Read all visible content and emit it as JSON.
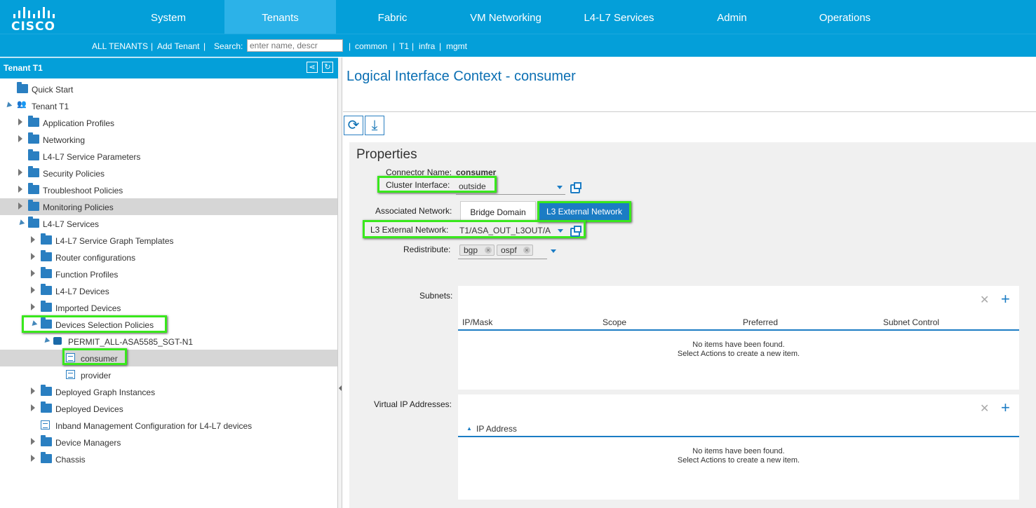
{
  "brand": {
    "name": "CISCO"
  },
  "nav": {
    "tabs": [
      "System",
      "Tenants",
      "Fabric",
      "VM Networking",
      "L4-L7 Services",
      "Admin",
      "Operations"
    ],
    "active": "Tenants"
  },
  "subnav": {
    "all_tenants": "ALL TENANTS",
    "add_tenant": "Add Tenant",
    "sep": "|",
    "search_label": "Search:",
    "search_placeholder": "enter name, descr",
    "tenants": [
      "common",
      "T1",
      "infra",
      "mgmt"
    ]
  },
  "tree": {
    "title": "Tenant T1",
    "items": [
      {
        "label": "Quick Start",
        "icon": "folder-icon"
      },
      {
        "label": "Tenant T1",
        "icon": "tenant-icon",
        "expanded": true
      },
      {
        "label": "Application Profiles",
        "icon": "folder-icon",
        "collapsed": true
      },
      {
        "label": "Networking",
        "icon": "folder-icon",
        "collapsed": true
      },
      {
        "label": "L4-L7 Service Parameters",
        "icon": "folder-icon"
      },
      {
        "label": "Security Policies",
        "icon": "folder-icon",
        "collapsed": true
      },
      {
        "label": "Troubleshoot Policies",
        "icon": "folder-icon",
        "collapsed": true
      },
      {
        "label": "Monitoring Policies",
        "icon": "folder-icon",
        "collapsed": true,
        "selected": true
      },
      {
        "label": "L4-L7 Services",
        "icon": "folder-icon",
        "expanded": true
      },
      {
        "label": "L4-L7 Service Graph Templates",
        "icon": "folder-icon",
        "collapsed": true
      },
      {
        "label": "Router configurations",
        "icon": "folder-icon",
        "collapsed": true
      },
      {
        "label": "Function Profiles",
        "icon": "folder-icon",
        "collapsed": true
      },
      {
        "label": "L4-L7 Devices",
        "icon": "folder-icon",
        "collapsed": true
      },
      {
        "label": "Imported Devices",
        "icon": "folder-icon",
        "collapsed": true
      },
      {
        "label": "Devices Selection Policies",
        "icon": "folder-icon",
        "expanded": true,
        "highlighted": true
      },
      {
        "label": "PERMIT_ALL-ASA5585_SGT-N1",
        "icon": "lock-icon",
        "expanded": true
      },
      {
        "label": "consumer",
        "icon": "document-icon",
        "selected": true,
        "highlighted": true
      },
      {
        "label": "provider",
        "icon": "document-icon"
      },
      {
        "label": "Deployed Graph Instances",
        "icon": "folder-icon",
        "collapsed": true
      },
      {
        "label": "Deployed Devices",
        "icon": "folder-icon",
        "collapsed": true
      },
      {
        "label": "Inband Management Configuration for L4-L7 devices",
        "icon": "document-icon"
      },
      {
        "label": "Device Managers",
        "icon": "folder-icon",
        "collapsed": true
      },
      {
        "label": "Chassis",
        "icon": "folder-icon",
        "collapsed": true
      }
    ]
  },
  "page": {
    "title": "Logical Interface Context - consumer"
  },
  "toolbar": {
    "refresh_icon": "refresh-icon",
    "download_icon": "download-icon"
  },
  "properties": {
    "title": "Properties",
    "connector_name_label": "Connector Name:",
    "connector_name": "consumer",
    "cluster_interface_label": "Cluster Interface:",
    "cluster_interface": "outside",
    "associated_network_label": "Associated Network:",
    "associated_network_options": [
      "Bridge Domain",
      "L3 External Network"
    ],
    "associated_network_selected": "L3 External Network",
    "l3_external_network_label": "L3 External Network:",
    "l3_external_network": "T1/ASA_OUT_L3OUT/A",
    "redistribute_label": "Redistribute:",
    "redistribute": [
      "bgp",
      "ospf"
    ],
    "subnets_label": "Subnets:",
    "subnets_columns": [
      "IP/Mask",
      "Scope",
      "Preferred",
      "Subnet Control"
    ],
    "empty_line1": "No items have been found.",
    "empty_line2": "Select Actions to create a new item.",
    "vip_label": "Virtual IP Addresses:",
    "vip_columns": [
      "IP Address"
    ]
  },
  "colors": {
    "brand_blue": "#049fd9",
    "highlight_green": "#39e81c",
    "accent_blue": "#1b7cc4"
  }
}
